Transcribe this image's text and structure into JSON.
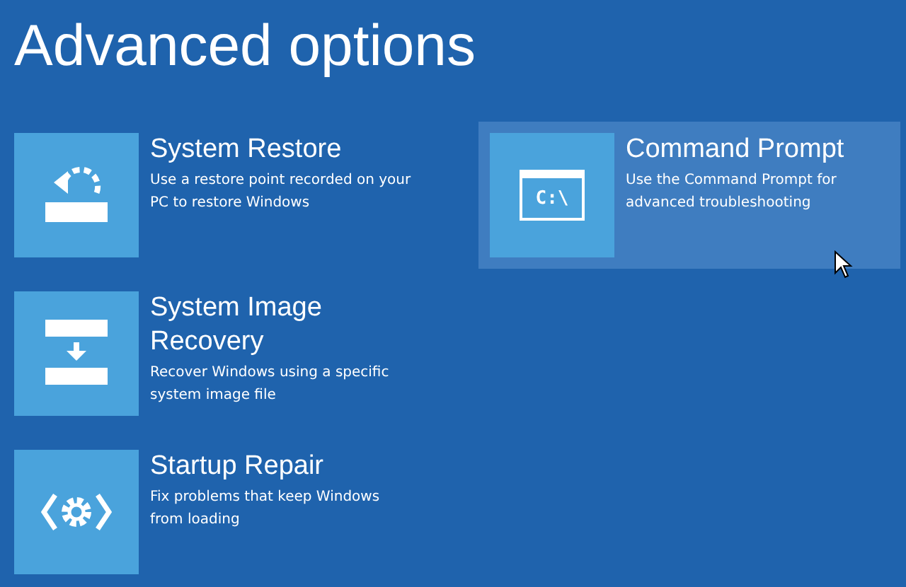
{
  "title": "Advanced options",
  "options": [
    {
      "kind": "restore",
      "title": "System Restore",
      "description": "Use a restore point recorded on your PC to restore Windows",
      "selected": false
    },
    {
      "kind": "image",
      "title": "System Image Recovery",
      "description": "Recover Windows using a specific system image file",
      "selected": false
    },
    {
      "kind": "repair",
      "title": "Startup Repair",
      "description": "Fix problems that keep Windows from loading",
      "selected": false
    },
    {
      "kind": "prompt",
      "title": "Command Prompt",
      "description": "Use the Command Prompt for advanced troubleshooting",
      "icon_text": "C:\\",
      "selected": true
    }
  ]
}
